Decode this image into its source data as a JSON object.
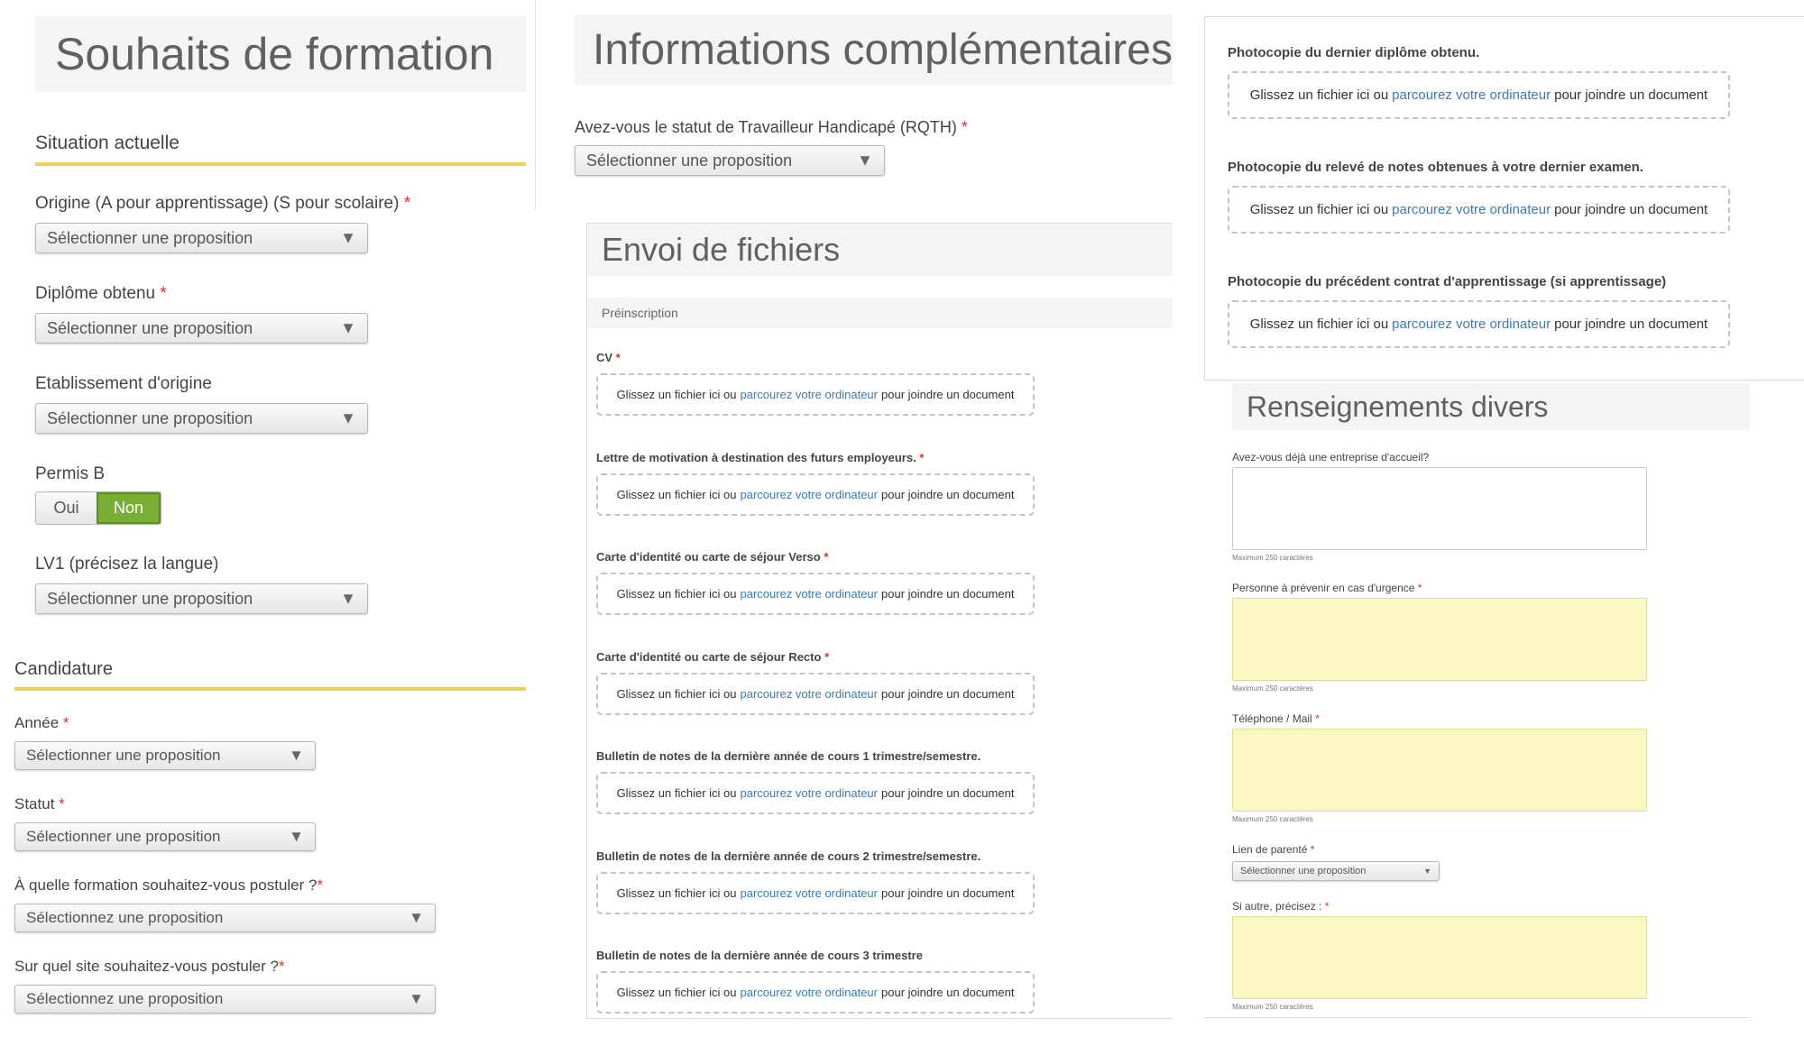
{
  "left": {
    "title": "Souhaits de formation",
    "situation": {
      "heading": "Situation actuelle",
      "origine_label": "Origine (A pour apprentissage) (S pour scolaire)",
      "diplome_label": "Diplôme obtenu",
      "etablissement_label": "Etablissement d'origine",
      "permis_label": "Permis B",
      "permis_oui": "Oui",
      "permis_non": "Non",
      "permis_selected": "Non",
      "lv1_label": "LV1 (précisez la langue)"
    },
    "candidature": {
      "heading": "Candidature",
      "annee_label": "Année",
      "statut_label": "Statut",
      "formation_label": "À quelle formation souhaitez-vous postuler ?",
      "site_label": "Sur quel site souhaitez-vous postuler ?",
      "select_alt": "Sélectionnez une proposition"
    },
    "select_placeholder": "Sélectionner une proposition",
    "required_mark": "*"
  },
  "middle": {
    "title": "Informations complémentaires",
    "rqth_label": "Avez-vous le statut de Travailleur Handicapé (RQTH)",
    "rqth_select": "Sélectionner une proposition",
    "envoi": {
      "title": "Envoi de fichiers",
      "subtitle": "Préinscription",
      "files": [
        {
          "label": "CV",
          "required": true
        },
        {
          "label": "Lettre de motivation à destination des futurs employeurs.",
          "required": true
        },
        {
          "label": "Carte d'identité ou carte de séjour Verso",
          "required": true
        },
        {
          "label": "Carte d'identité ou carte de séjour Recto",
          "required": true
        },
        {
          "label": "Bulletin de notes de la dernière année de cours 1 trimestre/semestre.",
          "required": false
        },
        {
          "label": "Bulletin de notes de la dernière année de cours 2 trimestre/semestre.",
          "required": false
        },
        {
          "label": "Bulletin de notes de la dernière année de cours 3 trimestre",
          "required": false
        }
      ]
    }
  },
  "dropzone": {
    "before": "Glissez un fichier ici ou",
    "link": "parcourez votre ordinateur",
    "after": "pour joindre un document"
  },
  "right": {
    "files": [
      {
        "label": "Photocopie du dernier diplôme obtenu."
      },
      {
        "label": "Photocopie du relevé de notes obtenues à votre dernier examen."
      },
      {
        "label": "Photocopie du précédent contrat d'apprentissage (si apprentissage)"
      }
    ],
    "renseignements": {
      "title": "Renseignements divers",
      "entreprise_label": "Avez-vous déjà une entreprise d'accueil?",
      "urgence_label": "Personne à prévenir en cas d'urgence",
      "telephone_label": "Téléphone / Mail",
      "parente_label": "Lien de parenté",
      "parente_select": "Sélectionner une proposition",
      "autre_label": "Si autre, précisez :",
      "max_hint": "Maximum 250 caractères"
    }
  }
}
